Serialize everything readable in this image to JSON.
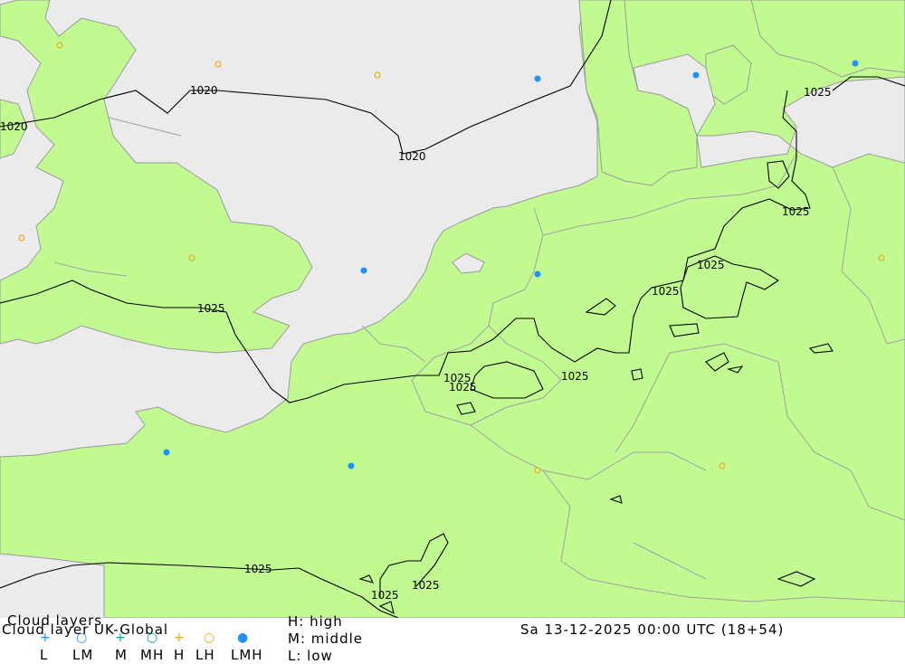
{
  "map": {
    "colors": {
      "sea": "#ebebeb",
      "land": "#c2fa92",
      "border": "#a0a0a0",
      "coast": "#9a9a9a",
      "isobar": "#000000",
      "dot_filled": "#1e90ff",
      "dot_open": "#f0a000"
    },
    "isobar_labels": [
      {
        "id": "1020-a",
        "text": "1020"
      },
      {
        "id": "1020-b",
        "text": "1020"
      },
      {
        "id": "1020-c",
        "text": "1020"
      },
      {
        "id": "1025-a",
        "text": "1025"
      },
      {
        "id": "1025-b",
        "text": "1025"
      },
      {
        "id": "1025-c",
        "text": "1025"
      },
      {
        "id": "1025-d",
        "text": "1025"
      },
      {
        "id": "1025-e",
        "text": "1025"
      },
      {
        "id": "1025-f",
        "text": "1025"
      },
      {
        "id": "1025-g",
        "text": "1025"
      },
      {
        "id": "1025-h",
        "text": "1025"
      },
      {
        "id": "1025-i",
        "text": "1025"
      },
      {
        "id": "1025-j",
        "text": "1025"
      },
      {
        "id": "1025-k",
        "text": "1025"
      }
    ]
  },
  "footer": {
    "title": "Cloud layers",
    "model_label": "Cloud layer   UK-Global",
    "datetime": "Sa 13-12-2025 00:00 UTC (18+54)",
    "legend_text": {
      "high": "H: high",
      "middle": "M: middle",
      "low": "L: low"
    },
    "legend_keys": [
      "L",
      "LM",
      "M",
      "MH",
      "H",
      "LH",
      "LMH"
    ]
  }
}
